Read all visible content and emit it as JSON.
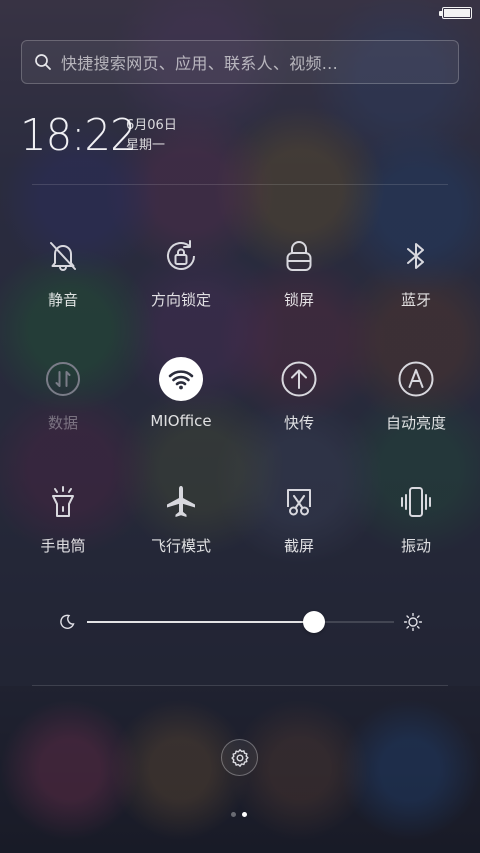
{
  "status_bar": {
    "battery_level": 1.0
  },
  "search": {
    "placeholder": "快捷搜索网页、应用、联系人、视频..."
  },
  "clock": {
    "time": "18:22",
    "date": "6月06日",
    "weekday": "星期一"
  },
  "toggles": [
    {
      "id": "mute",
      "label": "静音",
      "icon": "bell-off-icon",
      "active": false,
      "enabled": true
    },
    {
      "id": "rotation-lock",
      "label": "方向锁定",
      "icon": "rotation-lock-icon",
      "active": false,
      "enabled": true
    },
    {
      "id": "lock-screen",
      "label": "锁屏",
      "icon": "padlock-icon",
      "active": false,
      "enabled": true
    },
    {
      "id": "bluetooth",
      "label": "蓝牙",
      "icon": "bluetooth-icon",
      "active": false,
      "enabled": true
    },
    {
      "id": "data",
      "label": "数据",
      "icon": "mobile-data-icon",
      "active": false,
      "enabled": false
    },
    {
      "id": "wifi",
      "label": "MIOffice",
      "icon": "wifi-icon",
      "active": true,
      "enabled": true
    },
    {
      "id": "quick-transfer",
      "label": "快传",
      "icon": "upload-arrow-icon",
      "active": false,
      "enabled": true
    },
    {
      "id": "auto-brightness",
      "label": "自动亮度",
      "icon": "auto-brightness-icon",
      "active": false,
      "enabled": true
    },
    {
      "id": "flashlight",
      "label": "手电筒",
      "icon": "flashlight-icon",
      "active": false,
      "enabled": true
    },
    {
      "id": "airplane",
      "label": "飞行模式",
      "icon": "airplane-icon",
      "active": false,
      "enabled": true
    },
    {
      "id": "screenshot",
      "label": "截屏",
      "icon": "scissors-icon",
      "active": false,
      "enabled": true
    },
    {
      "id": "vibrate",
      "label": "振动",
      "icon": "vibrate-icon",
      "active": false,
      "enabled": true
    }
  ],
  "brightness": {
    "level": 0.74
  },
  "pager": {
    "pages": 2,
    "current": 2
  },
  "colors": {
    "accent": "#ffffff",
    "icon": "#d8d8de",
    "disabled": "#7a7c88"
  }
}
